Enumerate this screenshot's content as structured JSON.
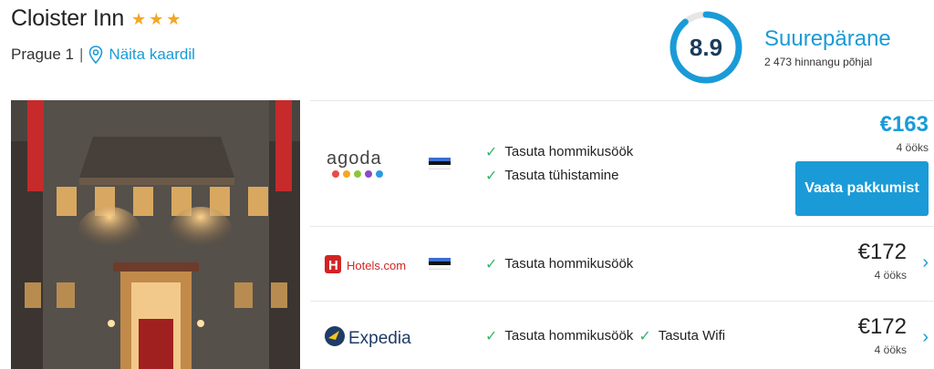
{
  "hotel": {
    "name": "Cloister Inn",
    "stars": 3,
    "location": "Prague 1",
    "separator": "|",
    "map_link": "Näita kaardil"
  },
  "rating": {
    "score": "8.9",
    "fraction": 0.89,
    "label": "Suurepärane",
    "count": "2 473 hinnangu põhjal",
    "color": "#1a9bd7"
  },
  "offers": [
    {
      "provider": "agoda",
      "logo_text": "agoda",
      "features": [
        "Tasuta hommikusöök",
        "Tasuta tühistamine"
      ],
      "price": "€163",
      "nights": "4 ööks",
      "cta": "Vaata pakkumist"
    },
    {
      "provider": "hotels-com",
      "logo_text": "Hotels.com",
      "features": [
        "Tasuta hommikusöök"
      ],
      "price": "€172",
      "nights": "4 ööks"
    },
    {
      "provider": "expedia",
      "logo_text": "Expedia",
      "features": [
        "Tasuta hommikusöök",
        "Tasuta Wifi"
      ],
      "price": "€172",
      "nights": "4 ööks"
    }
  ],
  "icons": {
    "star": "star-icon",
    "map_pin": "map-pin-icon",
    "check": "check-icon",
    "chevron": "chevron-right-icon",
    "flag": "estonia-flag-icon"
  }
}
